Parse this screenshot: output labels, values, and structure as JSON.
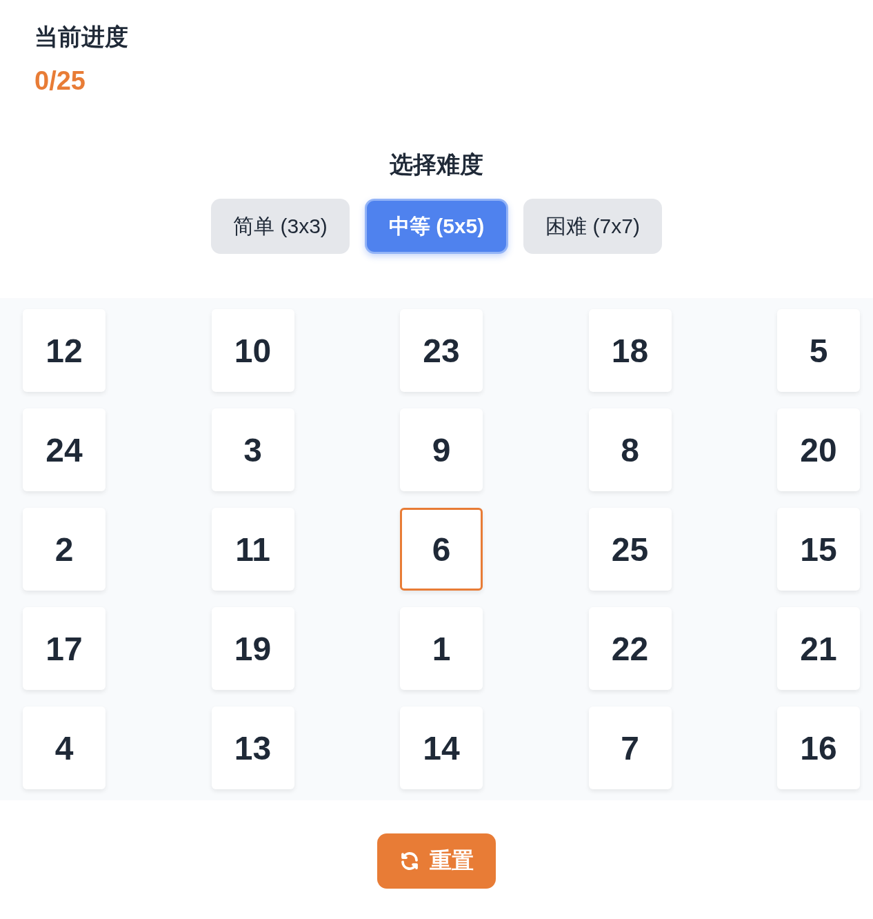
{
  "progress": {
    "label": "当前进度",
    "value": "0/25"
  },
  "difficulty": {
    "title": "选择难度",
    "options": [
      {
        "label": "简单 (3x3)",
        "selected": false
      },
      {
        "label": "中等 (5x5)",
        "selected": true
      },
      {
        "label": "困难 (7x7)",
        "selected": false
      }
    ]
  },
  "grid": {
    "cells": [
      {
        "number": "12",
        "highlighted": false
      },
      {
        "number": "10",
        "highlighted": false
      },
      {
        "number": "23",
        "highlighted": false
      },
      {
        "number": "18",
        "highlighted": false
      },
      {
        "number": "5",
        "highlighted": false
      },
      {
        "number": "24",
        "highlighted": false
      },
      {
        "number": "3",
        "highlighted": false
      },
      {
        "number": "9",
        "highlighted": false
      },
      {
        "number": "8",
        "highlighted": false
      },
      {
        "number": "20",
        "highlighted": false
      },
      {
        "number": "2",
        "highlighted": false
      },
      {
        "number": "11",
        "highlighted": false
      },
      {
        "number": "6",
        "highlighted": true
      },
      {
        "number": "25",
        "highlighted": false
      },
      {
        "number": "15",
        "highlighted": false
      },
      {
        "number": "17",
        "highlighted": false
      },
      {
        "number": "19",
        "highlighted": false
      },
      {
        "number": "1",
        "highlighted": false
      },
      {
        "number": "22",
        "highlighted": false
      },
      {
        "number": "21",
        "highlighted": false
      },
      {
        "number": "4",
        "highlighted": false
      },
      {
        "number": "13",
        "highlighted": false
      },
      {
        "number": "14",
        "highlighted": false
      },
      {
        "number": "7",
        "highlighted": false
      },
      {
        "number": "16",
        "highlighted": false
      }
    ]
  },
  "reset_button": {
    "label": "重置"
  }
}
